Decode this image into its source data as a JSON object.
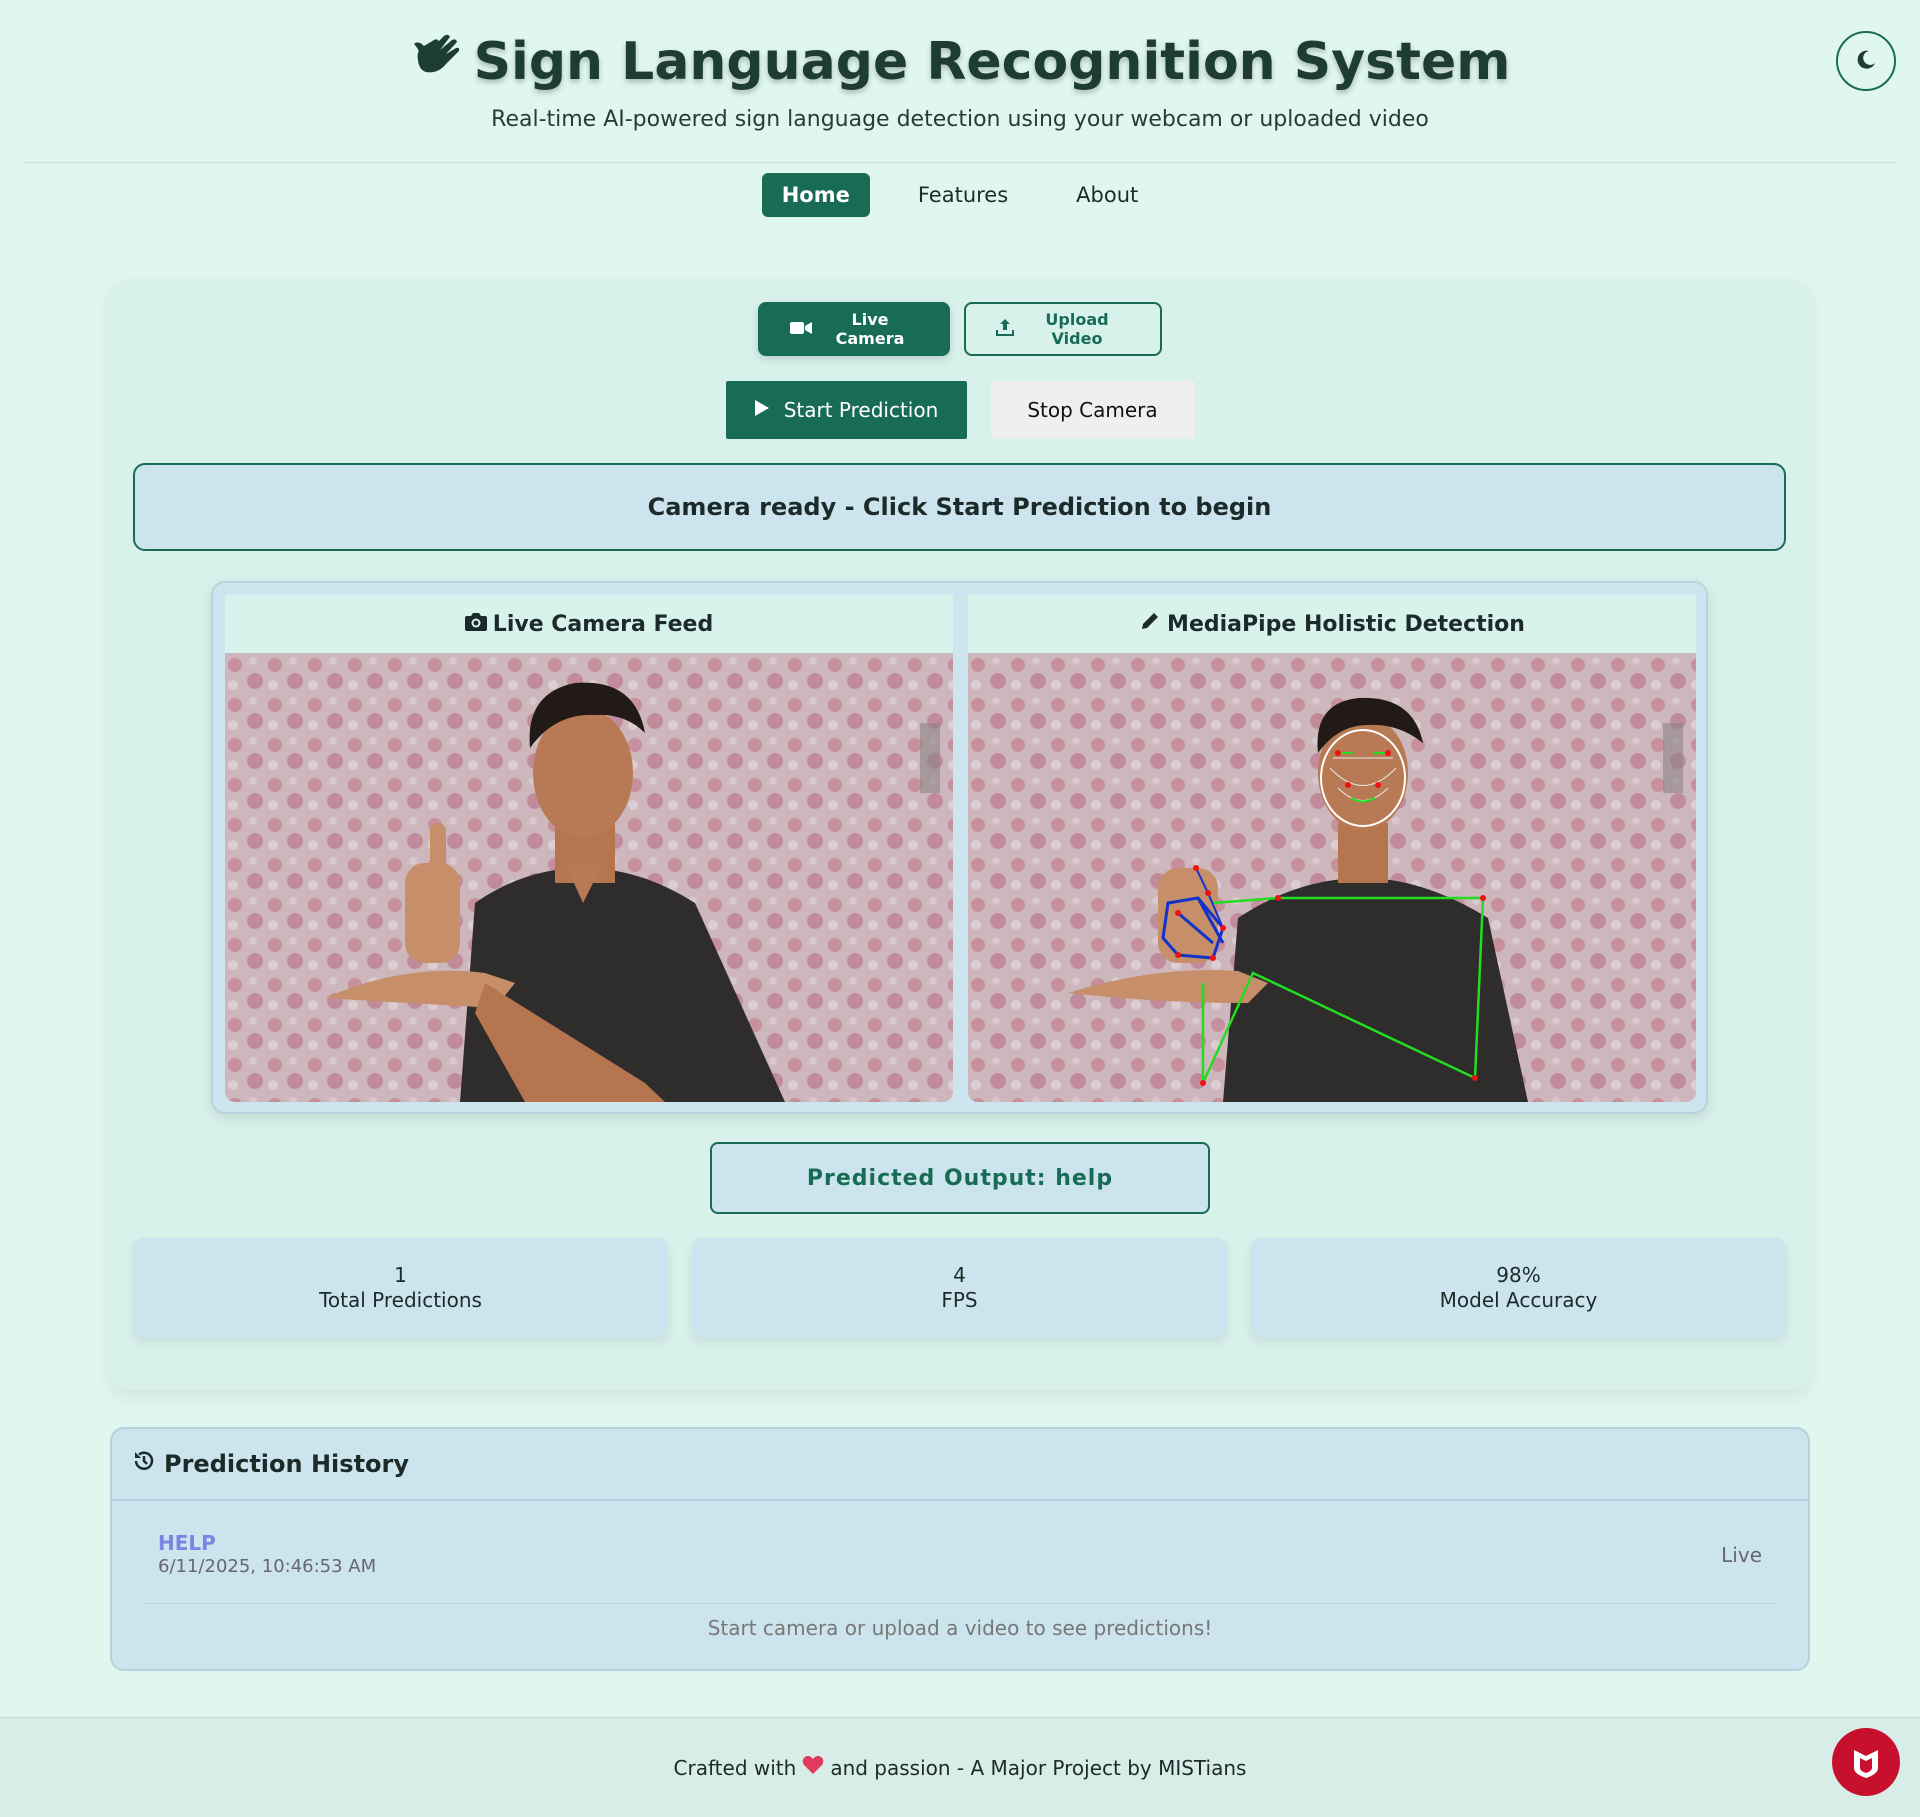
{
  "header": {
    "title": "Sign Language Recognition System",
    "subtitle": "Real-time AI-powered sign language detection using your webcam or uploaded video"
  },
  "nav": {
    "home": "Home",
    "features": "Features",
    "about": "About"
  },
  "modes": {
    "live": "Live Camera",
    "upload": "Upload Video"
  },
  "controls": {
    "start": "Start Prediction",
    "stop": "Stop Camera"
  },
  "status": "Camera ready - Click Start Prediction to begin",
  "panels": {
    "live": "Live Camera Feed",
    "holistic": "MediaPipe Holistic Detection"
  },
  "prediction": "Predicted Output: help",
  "stats": [
    {
      "value": "1",
      "label": "Total Predictions"
    },
    {
      "value": "4",
      "label": "FPS"
    },
    {
      "value": "98%",
      "label": "Model Accuracy"
    }
  ],
  "history": {
    "title": "Prediction History",
    "items": [
      {
        "word": "HELP",
        "time": "6/11/2025, 10:46:53 AM",
        "source": "Live"
      }
    ],
    "empty": "Start camera or upload a video to see predictions!"
  },
  "footer": {
    "prefix": "Crafted with",
    "suffix": "and passion - A Major Project by MISTians"
  },
  "colors": {
    "accent": "#186c55",
    "background": "#e0f7f0",
    "history_word": "#7b84e0"
  }
}
